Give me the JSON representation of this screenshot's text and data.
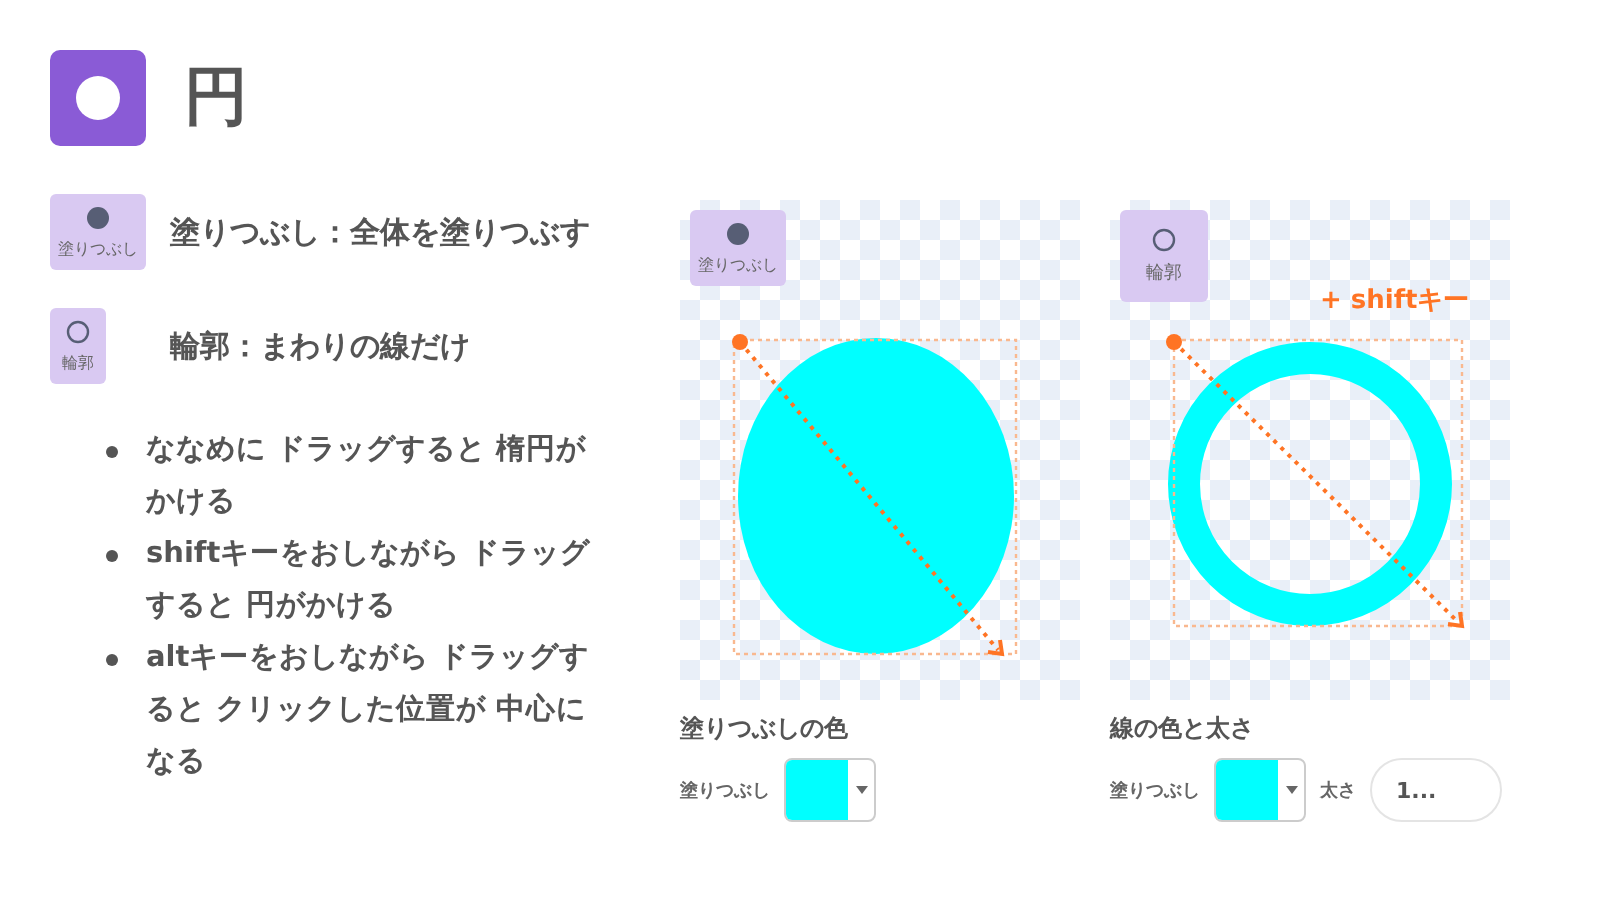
{
  "title": "円",
  "tools": [
    {
      "kind": "fill",
      "badge": "塗りつぶし",
      "description": "塗りつぶし：全体を塗りつぶす"
    },
    {
      "kind": "outline",
      "badge": "輪郭",
      "description": "輪郭：まわりの線だけ"
    }
  ],
  "tips": [
    "ななめに ドラッグすると 楕円がかける",
    "shiftキーをおしながら ドラッグすると 円がかける",
    "altキーをおしながら ドラッグすると クリックした位置が 中心になる"
  ],
  "examples": [
    {
      "kind": "fill",
      "badge": "塗りつぶし",
      "caption": "塗りつぶしの色",
      "control_label": "塗りつぶし",
      "color": "#00ffff"
    },
    {
      "kind": "outline",
      "badge": "輪郭",
      "annotation": "+ shiftキー",
      "caption": "線の色と太さ",
      "control_label": "塗りつぶし",
      "color": "#00ffff",
      "width_label": "太さ",
      "width_value": "1..."
    }
  ]
}
